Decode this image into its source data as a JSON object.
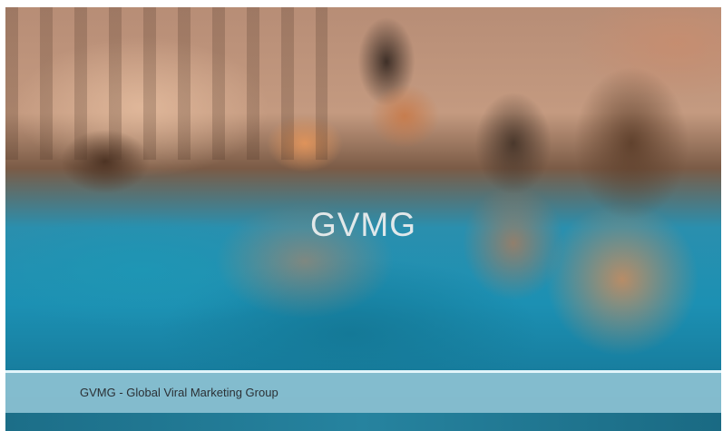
{
  "slide": {
    "title": "GVMG",
    "caption": "GVMG - Global Viral Marketing Group"
  },
  "colors": {
    "caption_bar": "#96c8d7",
    "title_text": "#f0f0f0",
    "caption_text": "#2b3035"
  }
}
